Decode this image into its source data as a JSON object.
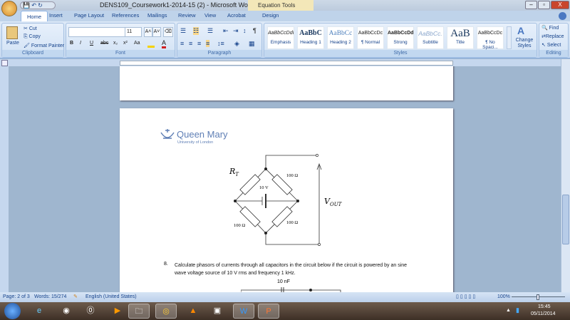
{
  "window": {
    "title": "DENS109_Coursework1-2014-15 (2) - Microsoft Word",
    "context_tab": "Equation Tools",
    "minimize": "–",
    "maximize": "▫",
    "close": "X"
  },
  "tabs": [
    "Home",
    "Insert",
    "Page Layout",
    "References",
    "Mailings",
    "Review",
    "View",
    "Acrobat",
    "Design"
  ],
  "clipboard": {
    "paste": "Paste",
    "cut": "Cut",
    "copy": "Copy",
    "format_painter": "Format Painter",
    "label": "Clipboard"
  },
  "font": {
    "name": "",
    "size": "11",
    "label": "Font",
    "bold": "B",
    "italic": "I",
    "underline": "U",
    "strike": "abc",
    "sub": "x₂",
    "sup": "x²",
    "case": "Aa",
    "grow": "A˄",
    "shrink": "A˅"
  },
  "paragraph": {
    "label": "Paragraph",
    "pilcrow": "¶"
  },
  "styles": {
    "label": "Styles",
    "items": [
      {
        "preview": "AaBbCcDdI",
        "name": "Emphasis"
      },
      {
        "preview": "AaBbC",
        "name": "Heading 1"
      },
      {
        "preview": "AaBbCc",
        "name": "Heading 2"
      },
      {
        "preview": "AaBbCcDc",
        "name": "¶ Normal"
      },
      {
        "preview": "AaBbCcDdI",
        "name": "Strong"
      },
      {
        "preview": "AaBbCc.",
        "name": "Subtitle"
      },
      {
        "preview": "AaB",
        "name": "Title"
      },
      {
        "preview": "AaBbCcDc",
        "name": "¶ No Spaci..."
      }
    ],
    "change_styles": "Change Styles"
  },
  "editing": {
    "label": "Editing",
    "find": "Find",
    "replace": "Replace",
    "select": "Select"
  },
  "document": {
    "logo_name": "Queen Mary",
    "logo_sub": "University of London",
    "circuit": {
      "rt": "R",
      "rt_sub": "T",
      "r1": "100 Ω",
      "r2": "100 Ω",
      "r3": "100 Ω",
      "source": "10 V",
      "vout": "V",
      "vout_sub": "OUT"
    },
    "question_number": "8.",
    "question_text": "Calculate phasors of currents through all capacitors in the circuit below if the circuit is powered by an sine wave voltage source of 10 V rms and frequency 1 kHz.",
    "cap_label": "10 nF"
  },
  "status": {
    "page": "Page: 2 of 3",
    "words": "Words: 15/274",
    "language": "English (United States)",
    "zoom": "100%"
  },
  "taskbar": {
    "time": "15:45",
    "date": "05/11/2014"
  }
}
